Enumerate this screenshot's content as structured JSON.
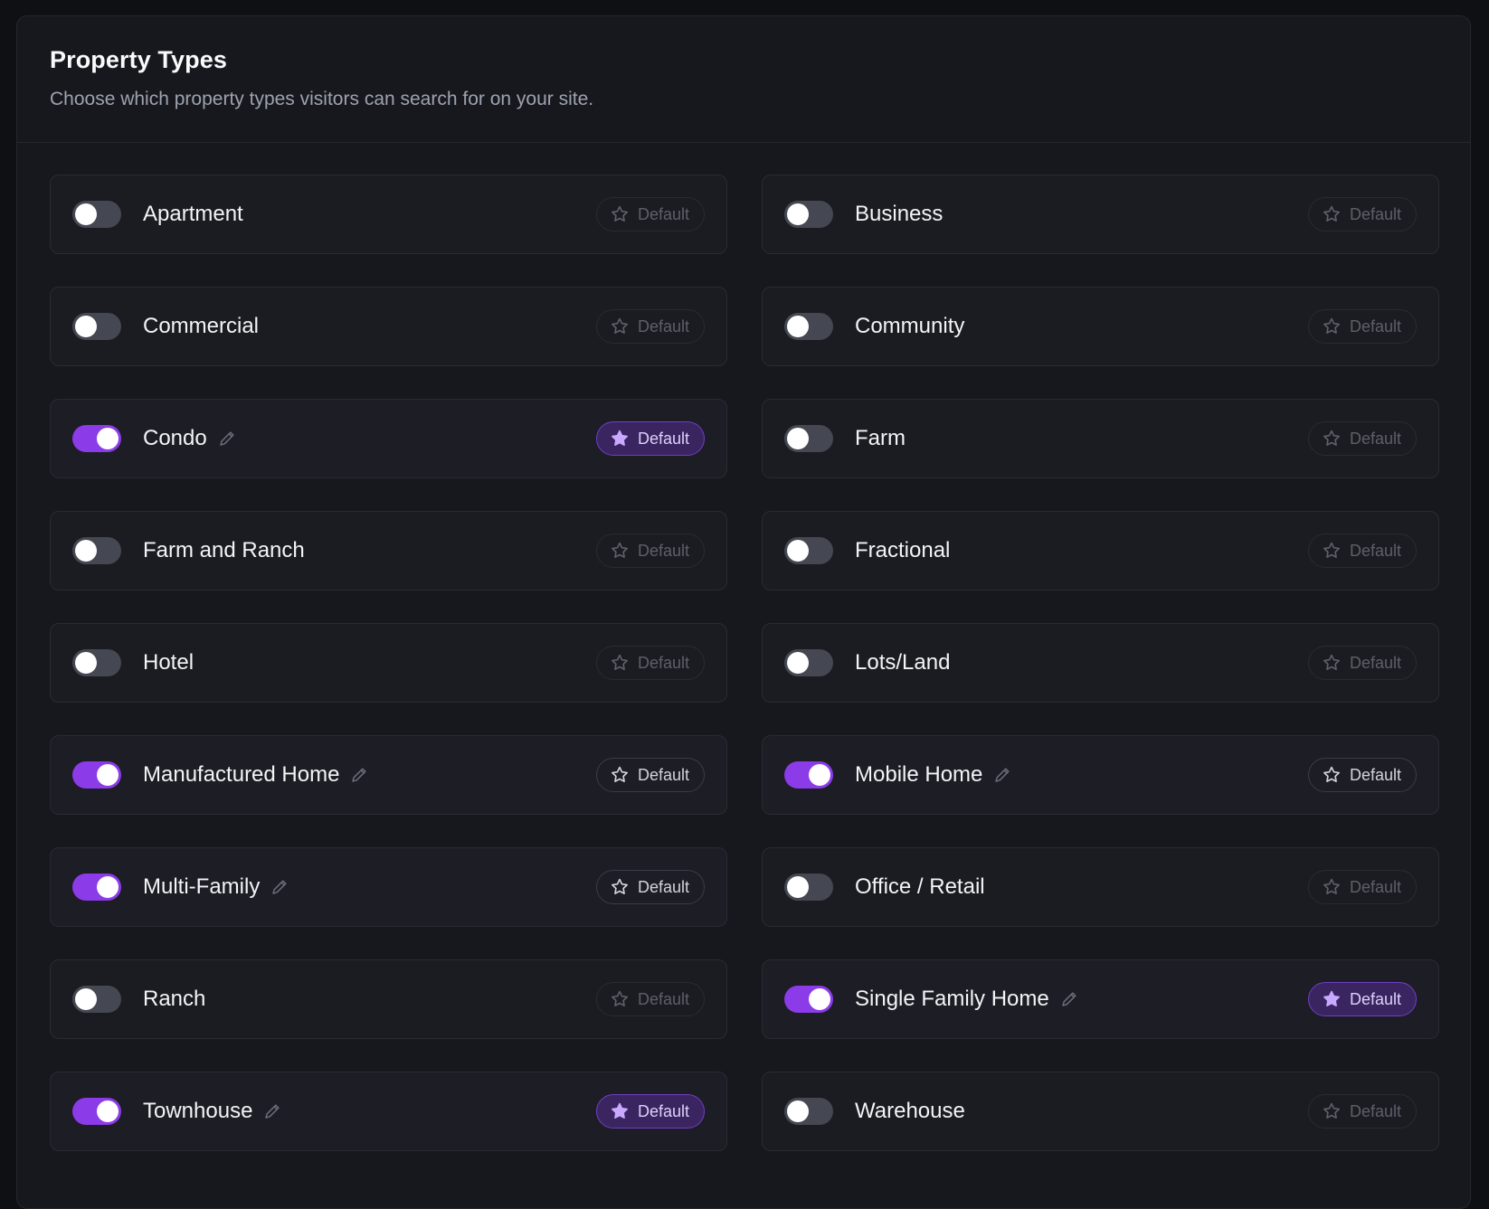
{
  "header": {
    "title": "Property Types",
    "subtitle": "Choose which property types visitors can search for on your site."
  },
  "colors": {
    "accent": "#8b3be8",
    "default_badge_bg": "#3b2560",
    "default_star": "#c9a8ff",
    "toggle_off": "#454852"
  },
  "default_label": "Default",
  "property_types": [
    {
      "label": "Apartment",
      "enabled": false,
      "is_default": false,
      "default_label": "Default"
    },
    {
      "label": "Business",
      "enabled": false,
      "is_default": false,
      "default_label": "Default"
    },
    {
      "label": "Commercial",
      "enabled": false,
      "is_default": false,
      "default_label": "Default"
    },
    {
      "label": "Community",
      "enabled": false,
      "is_default": false,
      "default_label": "Default"
    },
    {
      "label": "Condo",
      "enabled": true,
      "is_default": true,
      "default_label": "Default"
    },
    {
      "label": "Farm",
      "enabled": false,
      "is_default": false,
      "default_label": "Default"
    },
    {
      "label": "Farm and Ranch",
      "enabled": false,
      "is_default": false,
      "default_label": "Default"
    },
    {
      "label": "Fractional",
      "enabled": false,
      "is_default": false,
      "default_label": "Default"
    },
    {
      "label": "Hotel",
      "enabled": false,
      "is_default": false,
      "default_label": "Default"
    },
    {
      "label": "Lots/Land",
      "enabled": false,
      "is_default": false,
      "default_label": "Default"
    },
    {
      "label": "Manufactured Home",
      "enabled": true,
      "is_default": false,
      "default_label": "Default"
    },
    {
      "label": "Mobile Home",
      "enabled": true,
      "is_default": false,
      "default_label": "Default"
    },
    {
      "label": "Multi-Family",
      "enabled": true,
      "is_default": false,
      "default_label": "Default"
    },
    {
      "label": "Office / Retail",
      "enabled": false,
      "is_default": false,
      "default_label": "Default"
    },
    {
      "label": "Ranch",
      "enabled": false,
      "is_default": false,
      "default_label": "Default"
    },
    {
      "label": "Single Family Home",
      "enabled": true,
      "is_default": true,
      "default_label": "Default"
    },
    {
      "label": "Townhouse",
      "enabled": true,
      "is_default": true,
      "default_label": "Default"
    },
    {
      "label": "Warehouse",
      "enabled": false,
      "is_default": false,
      "default_label": "Default"
    }
  ]
}
